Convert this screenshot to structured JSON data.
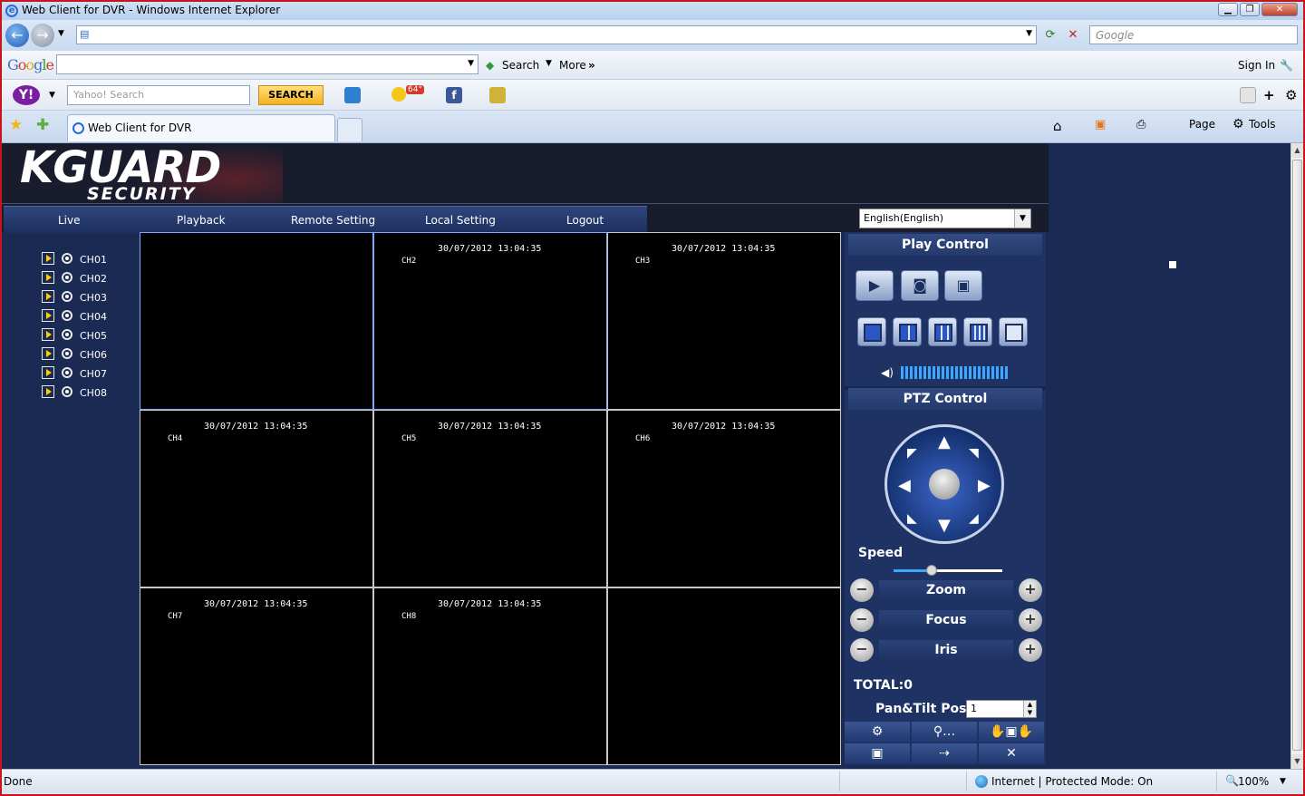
{
  "window": {
    "title": "Web Client for DVR - Windows Internet Explorer"
  },
  "browser": {
    "search_placeholder": "Google",
    "google_toolbar": {
      "search_label": "Search",
      "more_label": "More",
      "more_glyph": "»",
      "signin_label": "Sign In"
    },
    "yahoo_toolbar": {
      "search_placeholder": "Yahoo! Search",
      "search_button": "SEARCH",
      "weather": "64°"
    },
    "tab_title": "Web Client for DVR",
    "command_bar": {
      "page_label": "Page",
      "tools_label": "Tools"
    },
    "status": {
      "left": "Done",
      "zone": "Internet | Protected Mode: On",
      "zoom": "100%"
    }
  },
  "app": {
    "logo_top": "KGUARD",
    "logo_bottom": "SECURITY",
    "menu": [
      "Live",
      "Playback",
      "Remote Setting",
      "Local Setting",
      "Logout"
    ],
    "language": "English(English)",
    "channels": [
      "CH01",
      "CH02",
      "CH03",
      "CH04",
      "CH05",
      "CH06",
      "CH07",
      "CH08"
    ],
    "cells": [
      {
        "timestamp": "",
        "channel": ""
      },
      {
        "timestamp": "30/07/2012 13:04:35",
        "channel": "CH2"
      },
      {
        "timestamp": "30/07/2012 13:04:35",
        "channel": "CH3"
      },
      {
        "timestamp": "30/07/2012 13:04:35",
        "channel": "CH4"
      },
      {
        "timestamp": "30/07/2012 13:04:35",
        "channel": "CH5"
      },
      {
        "timestamp": "30/07/2012 13:04:35",
        "channel": "CH6"
      },
      {
        "timestamp": "30/07/2012 13:04:35",
        "channel": "CH7"
      },
      {
        "timestamp": "30/07/2012 13:04:35",
        "channel": "CH8"
      },
      {
        "timestamp": "",
        "channel": ""
      }
    ],
    "panel": {
      "play_control": "Play Control",
      "ptz_control": "PTZ Control",
      "speed_label": "Speed",
      "speed_value": 0.35,
      "zoom_label": "Zoom",
      "focus_label": "Focus",
      "iris_label": "Iris",
      "total_label": "TOTAL:0",
      "pan_tilt_label": "Pan&Tilt Pos:",
      "pan_tilt_value": "1"
    }
  }
}
